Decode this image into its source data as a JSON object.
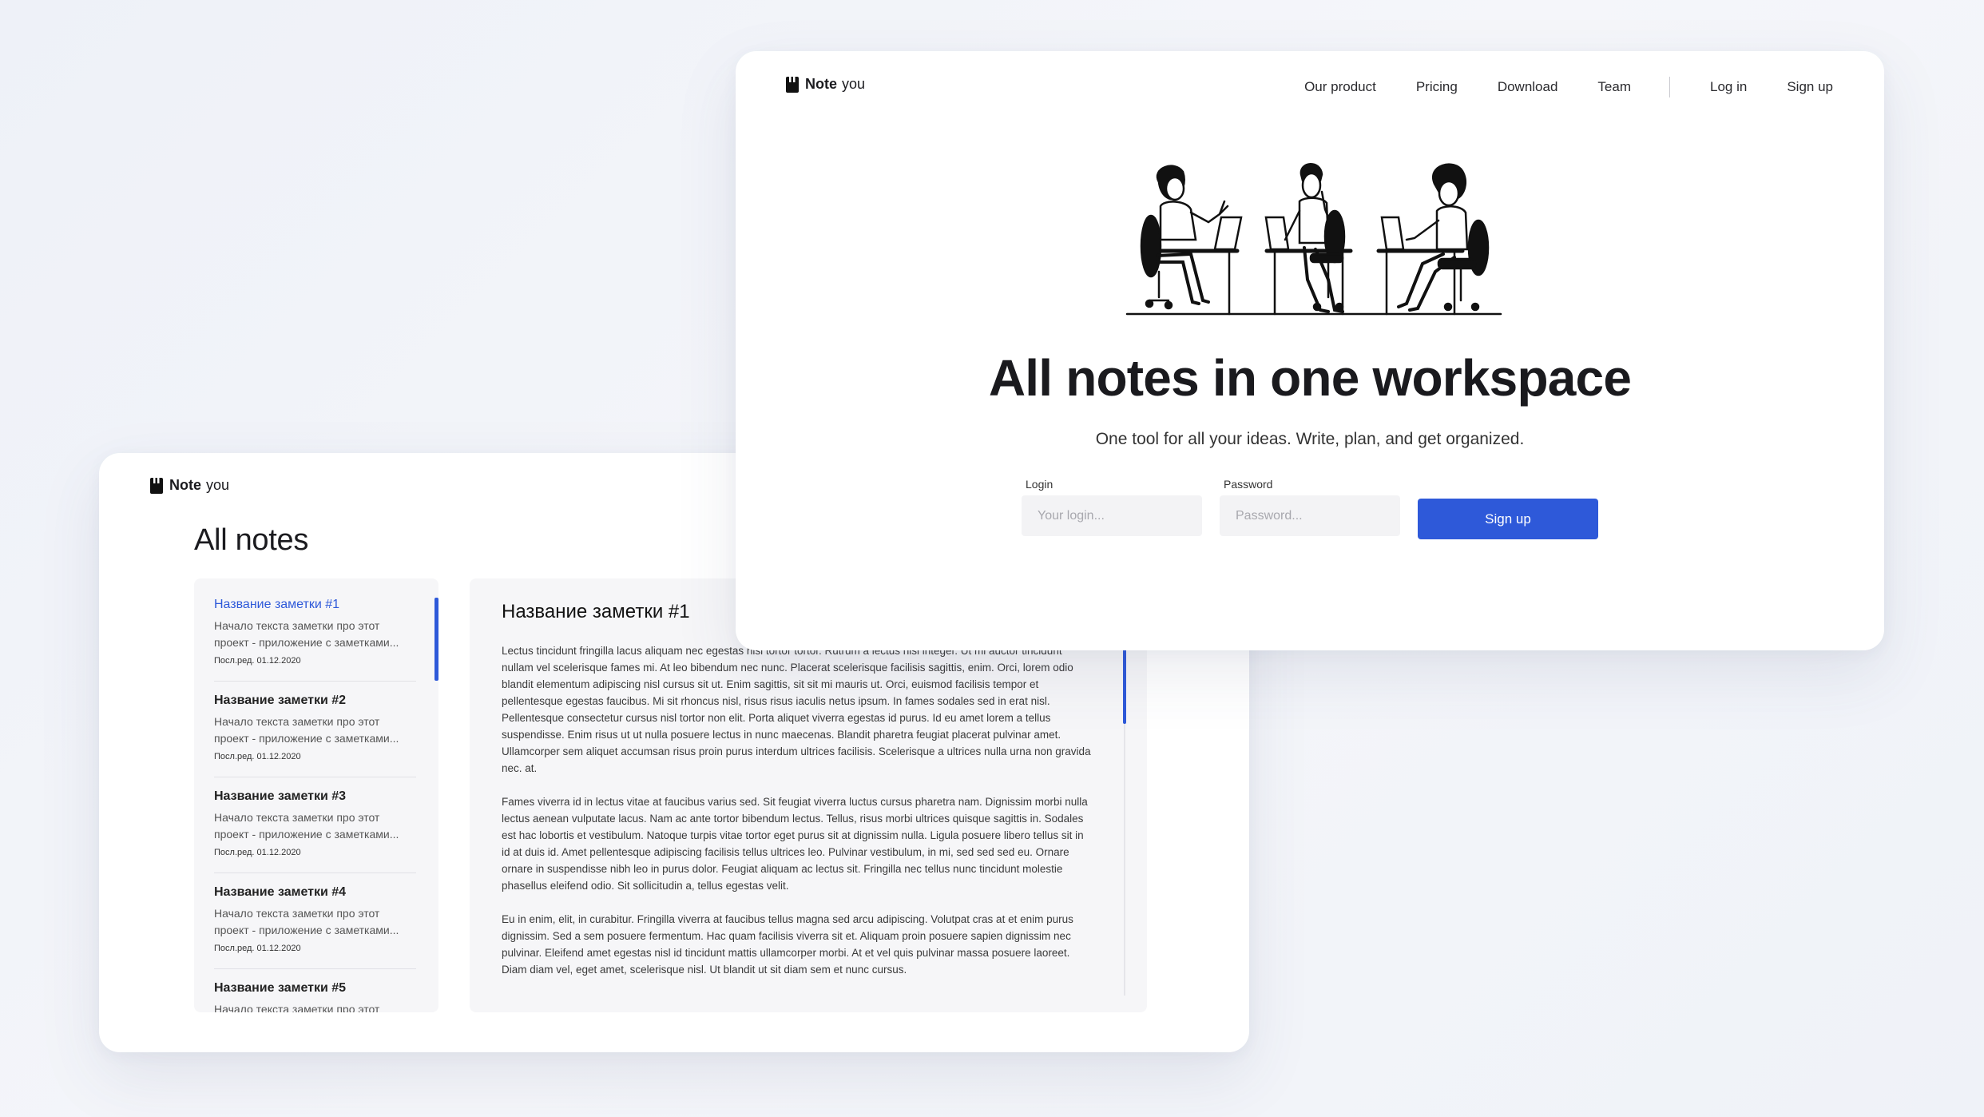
{
  "brand": {
    "name_bold": "Note",
    "name_light": "you"
  },
  "colors": {
    "accent": "#2e59d9",
    "background": "#f1f3f9",
    "card": "#ffffff",
    "panel": "#f6f6f8"
  },
  "landing": {
    "nav": {
      "items": [
        "Our product",
        "Pricing",
        "Download",
        "Team"
      ],
      "login": "Log in",
      "signup": "Sign up"
    },
    "hero": {
      "title": "All notes in one workspace",
      "subtitle": "One tool for all your ideas. Write, plan, and get organized."
    },
    "form": {
      "login_label": "Login",
      "login_placeholder": "Your login...",
      "password_label": "Password",
      "password_placeholder": "Password...",
      "submit": "Sign up"
    }
  },
  "notes_app": {
    "title": "All notes",
    "notes": [
      {
        "title": "Название заметки #1",
        "preview_line1": "Начало текста заметки про этот",
        "preview_line2": "проект - приложение с заметками...",
        "date": "Посл.ред. 01.12.2020",
        "active": true
      },
      {
        "title": "Название заметки #2",
        "preview_line1": "Начало текста заметки про этот",
        "preview_line2": "проект - приложение с заметками...",
        "date": "Посл.ред. 01.12.2020",
        "active": false
      },
      {
        "title": "Название заметки #3",
        "preview_line1": "Начало текста заметки про этот",
        "preview_line2": "проект - приложение с заметками...",
        "date": "Посл.ред. 01.12.2020",
        "active": false
      },
      {
        "title": "Название заметки #4",
        "preview_line1": "Начало текста заметки про этот",
        "preview_line2": "проект - приложение с заметками...",
        "date": "Посл.ред. 01.12.2020",
        "active": false
      },
      {
        "title": "Название заметки #5",
        "preview_line1": "Начало текста заметки про этот",
        "preview_line2": "",
        "date": "",
        "active": false
      }
    ],
    "editor": {
      "title": "Название заметки #1",
      "paragraphs": [
        "Lectus tincidunt fringilla lacus aliquam nec egestas nisl tortor tortor. Rutrum a lectus nisi integer. Ut mi auctor tincidunt nullam vel scelerisque fames mi. At leo bibendum nec nunc. Placerat scelerisque facilisis sagittis, enim. Orci, lorem odio blandit elementum adipiscing nisl cursus sit ut. Enim sagittis, sit sit mi mauris ut. Orci, euismod facilisis tempor et pellentesque egestas faucibus. Mi sit rhoncus nisl, risus risus iaculis netus ipsum. In fames sodales sed in erat nisl.",
        "Pellentesque consectetur cursus nisl tortor non elit. Porta aliquet viverra egestas id purus. Id eu amet lorem a tellus suspendisse. Enim risus ut ut nulla posuere lectus in nunc maecenas. Blandit pharetra feugiat placerat pulvinar amet. Ullamcorper sem aliquet accumsan risus proin purus interdum ultrices facilisis. Scelerisque a ultrices nulla urna non gravida nec. at.",
        "Fames viverra id in lectus vitae at faucibus varius sed. Sit feugiat viverra luctus cursus pharetra nam. Dignissim morbi nulla lectus aenean vulputate lacus. Nam ac ante tortor bibendum lectus. Tellus, risus morbi ultrices quisque sagittis in. Sodales est hac lobortis et vestibulum. Natoque turpis vitae tortor eget purus sit at dignissim nulla. Ligula posuere libero tellus sit in id at duis id. Amet pellentesque adipiscing facilisis tellus ultrices leo. Pulvinar vestibulum, in mi, sed sed sed eu. Ornare ornare in suspendisse nibh leo in purus dolor. Feugiat aliquam ac lectus sit. Fringilla nec tellus nunc tincidunt molestie phasellus eleifend odio. Sit sollicitudin a, tellus egestas velit.",
        "Eu in enim, elit, in curabitur. Fringilla viverra at faucibus tellus magna sed arcu adipiscing. Volutpat cras at et enim purus dignissim. Sed a sem posuere fermentum. Hac quam facilisis viverra sit et. Aliquam proin posuere sapien dignissim nec pulvinar. Eleifend amet egestas nisl id tincidunt mattis ullamcorper morbi. At et vel quis pulvinar massa posuere laoreet. Diam diam vel, eget amet, scelerisque nisl. Ut blandit ut sit diam sem et nunc cursus."
      ]
    }
  }
}
